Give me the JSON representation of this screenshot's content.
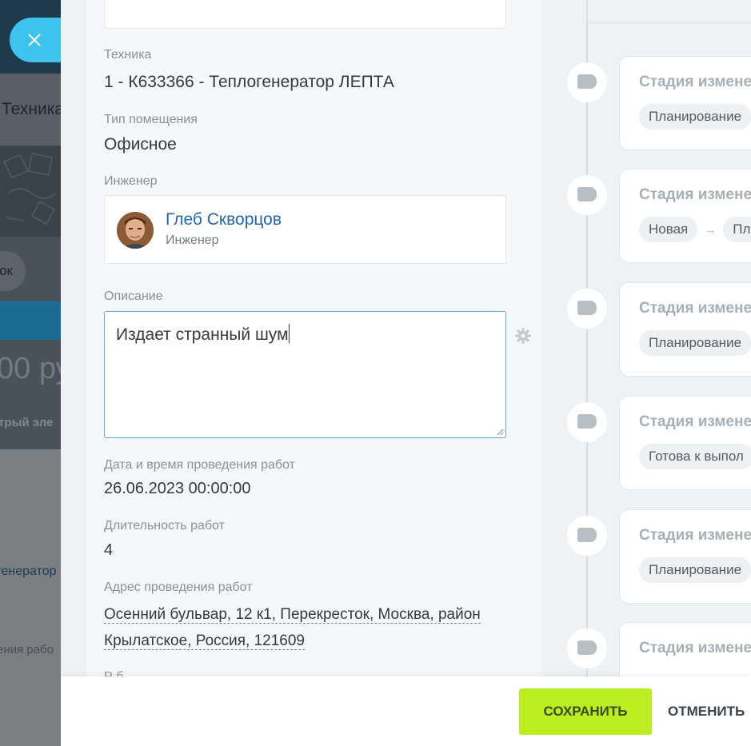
{
  "background": {
    "title_fragment": "Техника",
    "pill_fragment": "ок",
    "price_fragment": "00 ру",
    "fast_fragment": "трый эле",
    "generator_fragment": "генератор",
    "work_fragment": "ения рабо"
  },
  "form": {
    "equipment": {
      "label": "Техника",
      "value": "1 - К633366 - Теплогенератор ЛЕПТА"
    },
    "room_type": {
      "label": "Тип помещения",
      "value": "Офисное"
    },
    "engineer": {
      "label": "Инженер",
      "name": "Глеб Скворцов",
      "role": "Инженер"
    },
    "description": {
      "label": "Описание",
      "value": "Издает странный шум"
    },
    "datetime": {
      "label": "Дата и время проведения работ",
      "value": "26.06.2023 00:00:00"
    },
    "duration": {
      "label": "Длительность работ",
      "value": "4"
    },
    "address": {
      "label": "Адрес проведения работ",
      "line1": "Осенний бульвар, 12 к1, Перекресток, Москва, район",
      "line2": "Крылатское, Россия, 121609"
    },
    "next_label_fragment": "Р б"
  },
  "timeline": {
    "items": [
      {
        "title": "Стадия измене",
        "chips": [
          "Планирование"
        ]
      },
      {
        "title": "Стадия измене",
        "chips": [
          "Новая",
          "Пла"
        ]
      },
      {
        "title": "Стадия измене",
        "chips": [
          "Планирование"
        ]
      },
      {
        "title": "Стадия измене",
        "chips": [
          "Готова к выпол"
        ]
      },
      {
        "title": "Стадия измене",
        "chips": [
          "Планирование"
        ]
      },
      {
        "title": "Стадия измене",
        "chips": []
      }
    ],
    "arrow": "→"
  },
  "actions": {
    "save": "СОХРАНИТЬ",
    "cancel": "ОТМЕНИТЬ"
  },
  "colors": {
    "accent_save": "#bbed21",
    "link": "#2067b0",
    "close_button": "#3ec3ef"
  }
}
